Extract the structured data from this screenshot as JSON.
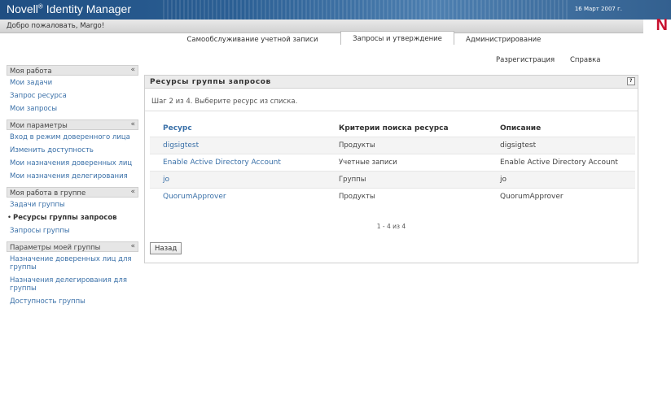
{
  "header": {
    "app_title_prefix": "Novell",
    "app_title_mark": "®",
    "app_title_suffix": " Identity Manager",
    "date": "16 Март 2007 г.",
    "welcome": "Добро пожаловать, Margo!",
    "brand_letter": "N",
    "brand_color": "#c8102e",
    "tabs": [
      {
        "label": "Самообслуживание учетной записи",
        "active": false
      },
      {
        "label": "Запросы и утверждение",
        "active": true
      },
      {
        "label": "Администрирование",
        "active": false
      }
    ]
  },
  "util_links": {
    "logout": "Разрегистрация",
    "help": "Справка"
  },
  "sidebar": {
    "collapse_glyph": "«",
    "groups": [
      {
        "title": "Моя работа",
        "items": [
          "Мои задачи",
          "Запрос ресурса",
          "Мои запросы"
        ]
      },
      {
        "title": "Мои параметры",
        "items": [
          "Вход в режим доверенного лица",
          "Изменить доступность",
          "Мои назначения доверенных лиц",
          "Мои назначения делегирования"
        ]
      },
      {
        "title": "Моя работа в группе",
        "items": [
          "Задачи группы",
          "Ресурсы группы запросов",
          "Запросы группы"
        ]
      },
      {
        "title": "Параметры моей группы",
        "items": [
          "Назначение доверенных лиц для группы",
          "Назначения делегирования для группы",
          "Доступность группы"
        ]
      }
    ],
    "active_item": "Ресурсы группы запросов"
  },
  "main": {
    "title": "Ресурсы группы запросов",
    "help_icon": "help-icon",
    "step_text": "Шаг 2 из 4. Выберите ресурс из списка.",
    "columns": [
      "Ресурс",
      "Критерии поиска ресурса",
      "Описание"
    ],
    "rows": [
      [
        "digsigtest",
        "Продукты",
        "digsigtest"
      ],
      [
        "Enable Active Directory Account",
        "Учетные записи",
        "Enable Active Directory Account"
      ],
      [
        "jo",
        "Группы",
        "jo"
      ],
      [
        "QuorumApprover",
        "Продукты",
        "QuorumApprover"
      ]
    ],
    "pager": "1 - 4 из 4",
    "back_label": "Назад"
  },
  "colors": {
    "link": "#3a70a8",
    "header_blue": "#1f4e82"
  }
}
